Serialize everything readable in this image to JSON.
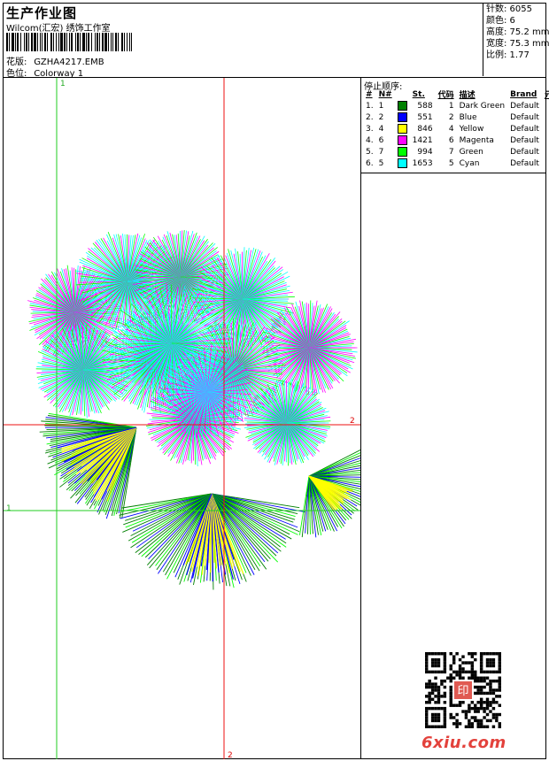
{
  "header": {
    "title": "生产作业图",
    "company": "Wilcom(汇宏) 绣饰工作室",
    "pattern_label": "花版:",
    "pattern_value": "GZHA4217.EMB",
    "colorway_label": "色位:",
    "colorway_value": "Colorway 1"
  },
  "stats": {
    "stitches": "针数: 6055",
    "colors": "颜色: 6",
    "height": "高度: 75.2 mm",
    "width": "宽度: 75.3 mm",
    "scale": "比例: 1.77"
  },
  "stop_sequence": {
    "title": "停止顺序:",
    "headers": [
      "#",
      "N#",
      "",
      "St.",
      "代码",
      "描述",
      "Brand",
      "元素"
    ],
    "rows": [
      {
        "idx": "1.",
        "n": "1",
        "color": "#008000",
        "st": "588",
        "code": "1",
        "desc": "Dark Green",
        "brand": "Default"
      },
      {
        "idx": "2.",
        "n": "2",
        "color": "#0000ff",
        "st": "551",
        "code": "2",
        "desc": "Blue",
        "brand": "Default"
      },
      {
        "idx": "3.",
        "n": "4",
        "color": "#ffff00",
        "st": "846",
        "code": "4",
        "desc": "Yellow",
        "brand": "Default"
      },
      {
        "idx": "4.",
        "n": "6",
        "color": "#ff00ff",
        "st": "1421",
        "code": "6",
        "desc": "Magenta",
        "brand": "Default"
      },
      {
        "idx": "5.",
        "n": "7",
        "color": "#00ff00",
        "st": "994",
        "code": "7",
        "desc": "Green",
        "brand": "Default"
      },
      {
        "idx": "6.",
        "n": "5",
        "color": "#00ffff",
        "st": "1653",
        "code": "5",
        "desc": "Cyan",
        "brand": "Default"
      }
    ]
  },
  "guides": {
    "green_top": "1",
    "green_left": "1",
    "red_right": "2",
    "red_bottom": "2"
  },
  "watermark": "6xiu.com",
  "qr_seal": "印"
}
